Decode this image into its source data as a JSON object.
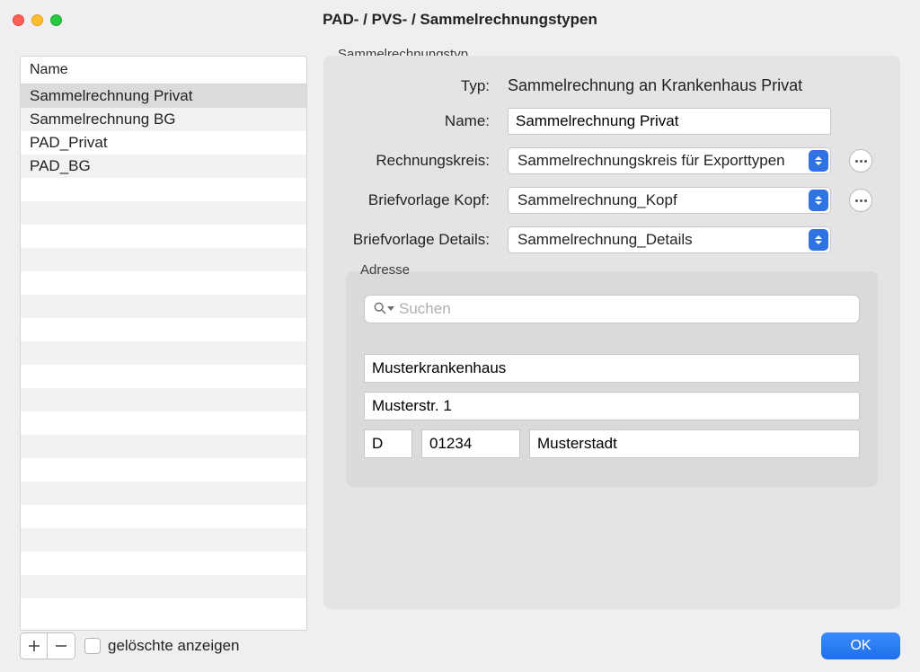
{
  "window": {
    "title": "PAD- / PVS- / Sammelrechnungstypen"
  },
  "list": {
    "header": "Name",
    "items": [
      "Sammelrechnung Privat",
      "Sammelrechnung BG",
      "PAD_Privat",
      "PAD_BG"
    ],
    "selected_index": 0,
    "total_visible_rows": 22
  },
  "footer": {
    "show_deleted_label": "gelöschte anzeigen",
    "ok_label": "OK"
  },
  "detail": {
    "group_label": "Sammelrechnungstyp",
    "fields": {
      "typ_label": "Typ:",
      "typ_value": "Sammelrechnung an Krankenhaus Privat",
      "name_label": "Name:",
      "name_value": "Sammelrechnung Privat",
      "rechnungskreis_label": "Rechnungskreis:",
      "rechnungskreis_value": "Sammelrechnungskreis für Exporttypen",
      "brief_kopf_label": "Briefvorlage Kopf:",
      "brief_kopf_value": "Sammelrechnung_Kopf",
      "brief_details_label": "Briefvorlage Details:",
      "brief_details_value": "Sammelrechnung_Details"
    },
    "address": {
      "group_label": "Adresse",
      "search_placeholder": "Suchen",
      "name": "Musterkrankenhaus",
      "street": "Musterstr. 1",
      "country": "D",
      "zip": "01234",
      "city": "Musterstadt"
    }
  }
}
